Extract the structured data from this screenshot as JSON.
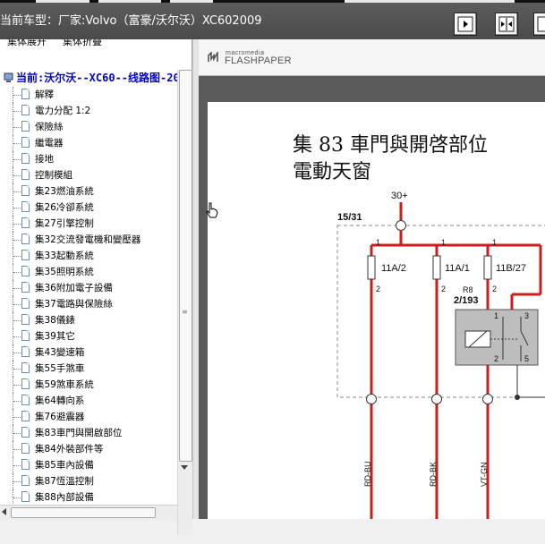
{
  "titlebar": {
    "title": "当前车型：厂家:Volvo（富豪/沃尔沃）XC602009"
  },
  "menu": {
    "items": [
      "集体展开",
      "集体折叠"
    ]
  },
  "tree": {
    "root_label": "当前:沃尔沃--XC60--线路图-20",
    "selected_index": 26,
    "items": [
      "解釋",
      "電力分配 1:2",
      "保險絲",
      "繼電器",
      "接地",
      "控制模組",
      "集23燃油系統",
      "集26冷卻系統",
      "集27引擎控制",
      "集32交流發電機和變壓器",
      "集33起動系統",
      "集35照明系統",
      "集36附加電子設備",
      "集37電路與保險絲",
      "集38儀錶",
      "集39其它",
      "集43變速箱",
      "集55手煞車",
      "集59煞車系統",
      "集64轉向系",
      "集76避震器",
      "集83車門與開啟部位",
      "集84外裝部件等",
      "集85車內設備",
      "集87恆溫控制",
      "集88內部設備"
    ]
  },
  "viewer": {
    "logo_small": "macromedia",
    "logo_big": "FLASHPAPER",
    "page_title_line1": "集 83 車門與開啓部位",
    "page_title_line2": "電動天窗"
  },
  "diagram": {
    "supply_label": "30+",
    "connector_label": "15/31",
    "fuses": [
      "11A/2",
      "11A/1",
      "11B/27"
    ],
    "pin_top": "1",
    "pin_bottom": "2",
    "relay_name": "R8",
    "relay_connector": "2/193",
    "relay_pins": [
      "1",
      "2",
      "3",
      "5"
    ],
    "wire_colors": [
      "RD-BU",
      "RD-BK",
      "VT-GN"
    ]
  },
  "colors": {
    "wire_red": "#c81e1e",
    "titlebar": "#555555",
    "tree_root": "#0000cc"
  }
}
